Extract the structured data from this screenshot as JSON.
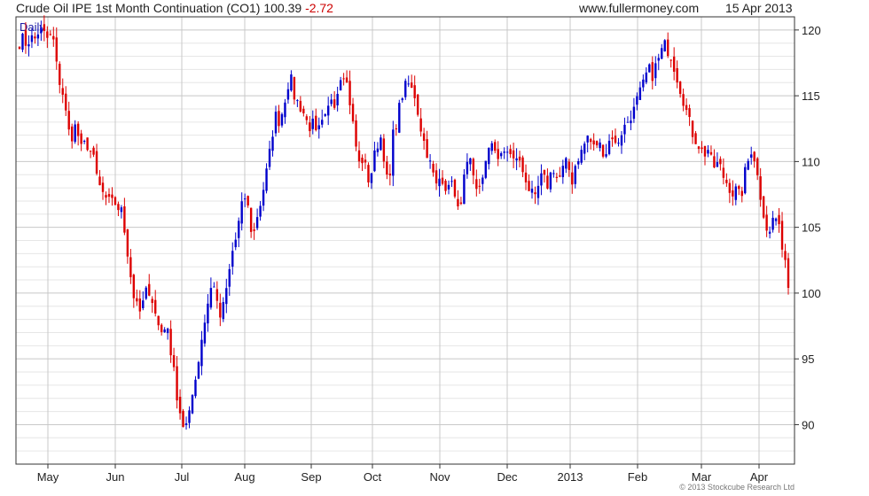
{
  "header": {
    "title": "Crude Oil IPE 1st Month Continuation (CO1) 100.39",
    "change": "-2.72",
    "site": "www.fullermoney.com",
    "date": "15 Apr 2013"
  },
  "footer": {
    "copyright": "© 2013 Stockcube Research Ltd"
  },
  "colors": {
    "up": "#0000cc",
    "down": "#dd0000",
    "grid_major": "#c8c8c8",
    "grid_minor": "#e6e6e6",
    "axis": "#333333",
    "label_daily": "#1a1aa6"
  },
  "chart_data": {
    "type": "candlestick",
    "period_label": "Daily",
    "x_ticks": [
      "May",
      "Jun",
      "Jul",
      "Aug",
      "Sep",
      "Oct",
      "Nov",
      "Dec",
      "2013",
      "Feb",
      "Mar",
      "Apr"
    ],
    "y_ticks": [
      90,
      95,
      100,
      105,
      110,
      115,
      120
    ],
    "ylim": [
      87,
      121
    ],
    "grid": true,
    "y_axis_side": "right",
    "closes": [
      119.0,
      119.4,
      118.8,
      119.5,
      119.2,
      119.8,
      120.0,
      119.6,
      119.2,
      119.8,
      117.5,
      116.0,
      115.0,
      113.0,
      111.5,
      112.8,
      112.0,
      110.8,
      111.5,
      111.0,
      110.5,
      109.0,
      108.0,
      107.5,
      106.5,
      107.5,
      107.0,
      106.0,
      106.8,
      104.0,
      102.0,
      100.0,
      99.0,
      98.5,
      99.5,
      100.5,
      99.8,
      98.5,
      97.5,
      97.0,
      97.8,
      96.0,
      95.0,
      92.0,
      90.5,
      89.0,
      91.0,
      92.0,
      93.5,
      95.0,
      97.0,
      98.5,
      100.0,
      101.0,
      99.0,
      98.0,
      99.5,
      101.0,
      103.0,
      104.0,
      105.5,
      107.0,
      107.5,
      105.0,
      104.5,
      106.0,
      107.0,
      108.5,
      110.0,
      112.0,
      113.5,
      113.0,
      114.0,
      115.5,
      116.5,
      115.0,
      114.5,
      114.0,
      113.5,
      112.5,
      113.0,
      112.0,
      112.5,
      113.0,
      113.5,
      115.0,
      114.5,
      115.5,
      117.0,
      116.5,
      115.0,
      113.0,
      111.0,
      109.5,
      110.5,
      108.5,
      109.0,
      110.5,
      111.5,
      112.0,
      109.0,
      108.0,
      112.0,
      113.0,
      114.5,
      115.5,
      116.0,
      115.5,
      115.0,
      113.5,
      112.0,
      111.0,
      110.0,
      109.0,
      108.0,
      109.0,
      108.5,
      107.5,
      109.0,
      107.0,
      106.0,
      108.0,
      109.5,
      110.0,
      108.5,
      107.5,
      108.5,
      109.5,
      110.5,
      111.5,
      111.0,
      110.0,
      110.5,
      111.0,
      110.5,
      110.0,
      110.5,
      109.5,
      109.0,
      108.0,
      107.5,
      107.0,
      108.5,
      109.0,
      108.0,
      109.0,
      109.5,
      108.5,
      109.0,
      110.0,
      109.5,
      108.5,
      110.0,
      110.5,
      111.0,
      112.0,
      111.5,
      111.0,
      111.5,
      111.0,
      110.5,
      111.5,
      112.0,
      111.0,
      112.0,
      112.5,
      113.0,
      113.5,
      114.0,
      115.0,
      115.5,
      116.5,
      117.0,
      116.5,
      117.5,
      118.0,
      119.0,
      118.5,
      118.0,
      117.0,
      116.0,
      115.0,
      114.0,
      113.0,
      112.0,
      111.5,
      111.0,
      110.5,
      111.0,
      110.0,
      109.5,
      110.0,
      109.0,
      108.5,
      108.0,
      107.5,
      108.0,
      107.0,
      109.0,
      110.0,
      111.0,
      110.0,
      108.0,
      106.5,
      105.0,
      104.5,
      106.0,
      105.5,
      104.0,
      103.0,
      100.4
    ],
    "bar_count": 250,
    "last_close": 100.39
  }
}
